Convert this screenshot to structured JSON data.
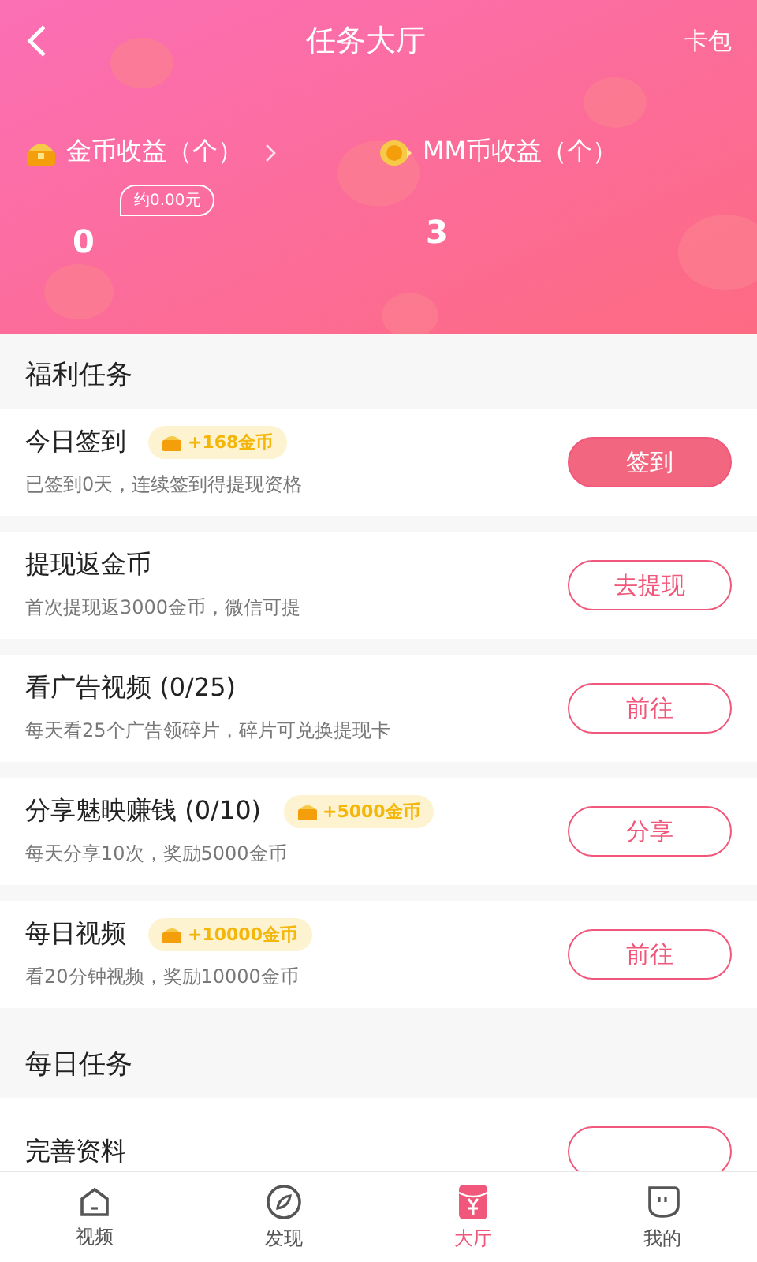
{
  "header": {
    "title": "任务大厅",
    "action": "卡包",
    "stats": [
      {
        "kind": "gold",
        "label": "金币收益（个）",
        "has_arrow": true,
        "note": "约0.00元",
        "value": "0"
      },
      {
        "kind": "mm",
        "label": "MM币收益（个）",
        "has_arrow": false,
        "value": "3"
      }
    ]
  },
  "sections": [
    {
      "title": "福利任务",
      "tasks": [
        {
          "title": "今日签到",
          "reward": "+168金币",
          "desc": "已签到0天，连续签到得提现资格",
          "button": "签到",
          "filled": true
        },
        {
          "title": "提现返金币",
          "desc": "首次提现返3000金币，微信可提",
          "button": "去提现",
          "filled": false
        },
        {
          "title": "看广告视频 (0/25)",
          "desc": "每天看25个广告领碎片，碎片可兑换提现卡",
          "button": "前往",
          "filled": false
        },
        {
          "title": "分享魅映赚钱 (0/10)",
          "reward": "+5000金币",
          "desc": "每天分享10次，奖励5000金币",
          "button": "分享",
          "filled": false
        },
        {
          "title": "每日视频",
          "reward": "+10000金币",
          "desc": "看20分钟视频，奖励10000金币",
          "button": "前往",
          "filled": false
        }
      ]
    },
    {
      "title": "每日任务",
      "tasks": [
        {
          "title": "完善资料",
          "filled": false
        }
      ]
    }
  ],
  "nav": [
    {
      "kind": "video",
      "label": "视频",
      "selected": false
    },
    {
      "kind": "discover",
      "label": "发现",
      "selected": false
    },
    {
      "kind": "hall",
      "label": "大厅",
      "selected": true
    },
    {
      "kind": "me",
      "label": "我的",
      "selected": false
    }
  ]
}
